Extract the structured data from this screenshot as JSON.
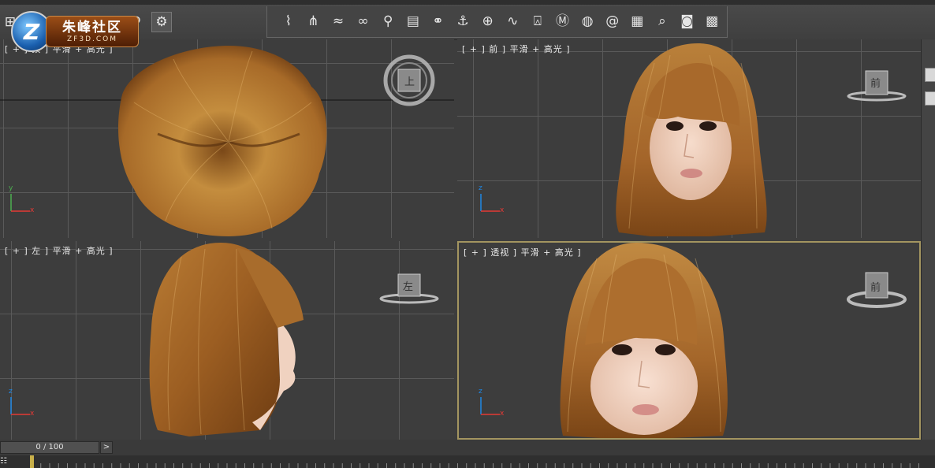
{
  "logo": {
    "badge_letter": "Z",
    "name_cn": "朱峰社区",
    "name_en": "ZF3D.COM"
  },
  "toolbar": {
    "left_icons": [
      "grid-icon",
      "box-icon",
      "layers-icon",
      "stack-icon",
      "brush-icon",
      "magnifier-icon",
      "gear-icon"
    ],
    "left_glyphs": [
      "⊞",
      "▭",
      "◫",
      "☰",
      "✎",
      "⚲",
      "⚙"
    ],
    "right_icons": [
      "hair-brush-icon",
      "comb-icon",
      "wave-icon",
      "loop-icon",
      "figure-icon",
      "panel-icon",
      "link-icon",
      "anchor-icon",
      "globe-icon",
      "tilde-icon",
      "shirt-icon",
      "material-icon",
      "sphere-icon",
      "spiral-icon",
      "render-setup-icon",
      "render-frame-icon",
      "camera-icon",
      "film-icon"
    ],
    "right_glyphs": [
      "⌇",
      "⋔",
      "≈",
      "∞",
      "⚲",
      "▤",
      "⚭",
      "⚓",
      "⊕",
      "∿",
      "⍓",
      "Ⓜ",
      "◍",
      "@",
      "▦",
      "⌕",
      "◙",
      "▩"
    ]
  },
  "viewports": {
    "top": {
      "label": "[ + ] 顶 ] 平滑 + 高光 ]",
      "cube_label": "上"
    },
    "front": {
      "label": "[ + ] 前 ] 平滑 + 高光 ]",
      "cube_label": "前"
    },
    "left": {
      "label": "[ + ] 左 ] 平滑 + 高光 ]",
      "cube_label": "左"
    },
    "perspective": {
      "label": "[ + ] 透视 ] 平滑 + 高光 ]",
      "cube_label": "前"
    }
  },
  "axes": {
    "x": "x",
    "y": "y",
    "z": "z"
  },
  "timeline": {
    "frame_display": "0 / 100",
    "next_label": ">"
  },
  "colors": {
    "hair_light": "#c9923f",
    "hair_dark": "#6e3d14",
    "skin": "#f0d2c0",
    "active_border": "#a39560",
    "viewport_bg": "#3d3d3d"
  }
}
